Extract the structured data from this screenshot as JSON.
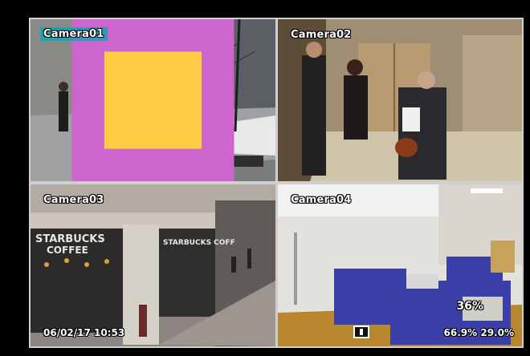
{
  "cameras": [
    {
      "label": "Camera01"
    },
    {
      "label": "Camera02"
    },
    {
      "label": "Camera03"
    },
    {
      "label": "Camera04"
    }
  ],
  "osd": {
    "timestamp": "06/02/17 10:53",
    "status_small": "66.9% 29.0%",
    "status_big": "36%"
  },
  "scene_text": {
    "storefront_sign": "STARBUCKS COFFEE",
    "storefront_sign2": "STARBUCKS COFFEE"
  },
  "colors": {
    "label_highlight": "#00aabe",
    "cubicle_blue": "#3b3fa8",
    "grid_border": "#cfcfcf"
  }
}
